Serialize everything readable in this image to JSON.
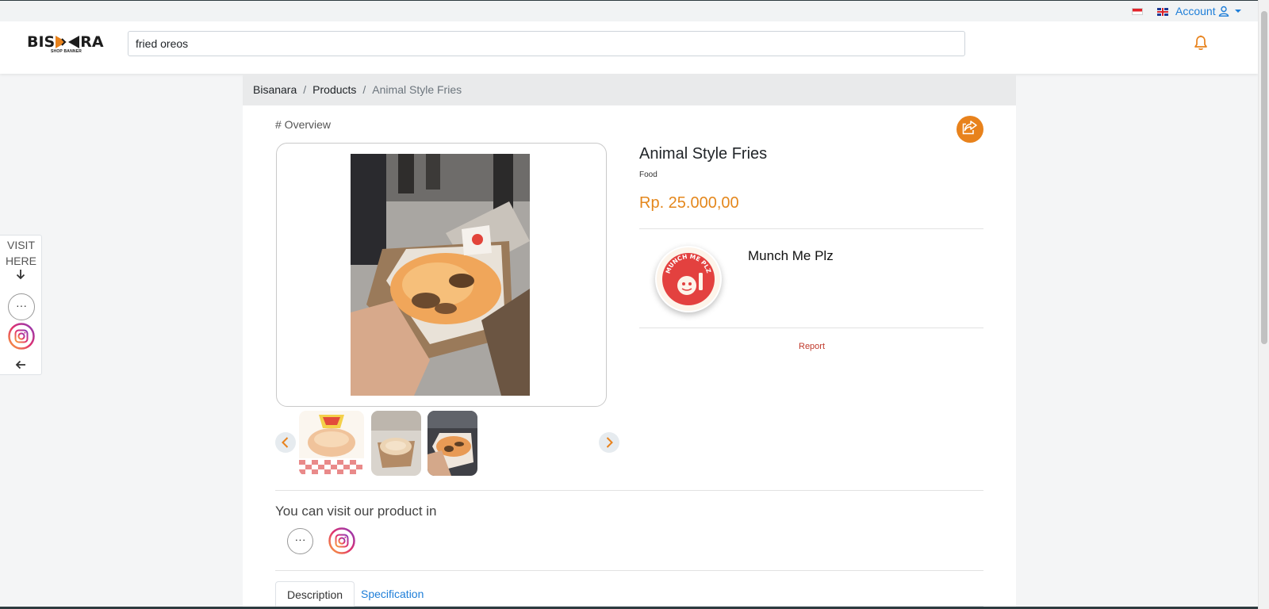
{
  "topbar": {
    "account_label": "Account",
    "flags": [
      "indonesia-flag-icon",
      "uk-flag-icon"
    ]
  },
  "header": {
    "logo_text_left": "BIS",
    "logo_text_right": "RA",
    "logo_sub": "SHOP BANNER",
    "search_value": "fried oreos"
  },
  "breadcrumb": {
    "items": [
      "Bisanara",
      "Products",
      "Animal Style Fries"
    ],
    "separator": "/"
  },
  "overview_label": "# Overview",
  "product": {
    "title": "Animal Style Fries",
    "category": "Food",
    "price": "Rp. 25.000,00"
  },
  "seller": {
    "name": "Munch Me Plz",
    "logo_text": "MUNCH ME PLZ"
  },
  "report_label": "Report",
  "sidebar": {
    "visit_line1": "VISIT",
    "visit_line2": "HERE",
    "more_label": "···"
  },
  "visit_section": {
    "heading": "You can visit our product in",
    "more_label": "···"
  },
  "tabs": {
    "description": "Description",
    "specification": "Specification"
  },
  "colors": {
    "accent_orange": "#e8821c",
    "link_blue": "#1e7ed8",
    "report_red": "#c0392b"
  }
}
